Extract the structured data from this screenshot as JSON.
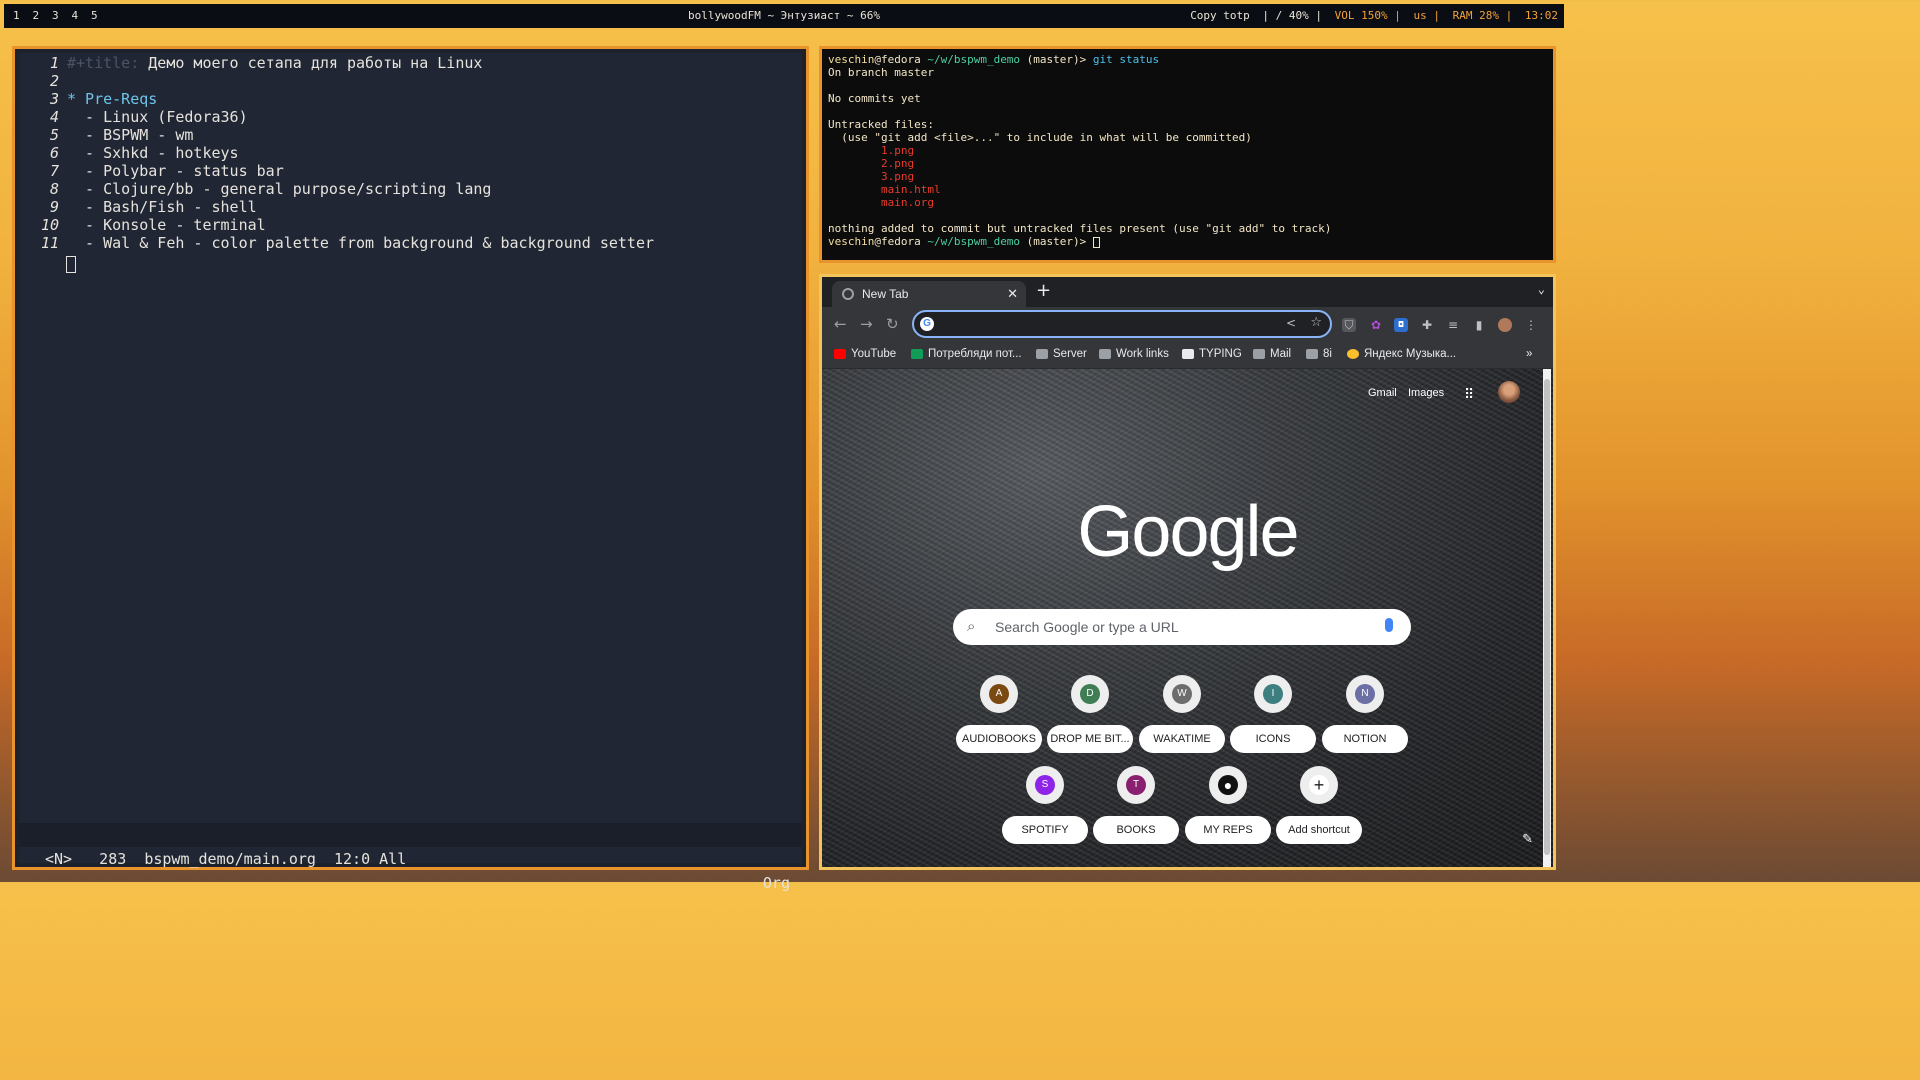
{
  "bar": {
    "workspaces": [
      "1",
      "2",
      "3",
      "4",
      "5"
    ],
    "center": "bollywoodFM ~ Энтузиаст ~ 66%",
    "right": {
      "copy": "Copy totp",
      "disk": " | / 40% |",
      "vol": " VOL 150% |",
      "lang": " us |",
      "ram": " RAM 28% |",
      "time": " 13:02"
    }
  },
  "editor": {
    "lines": [
      {
        "n": "1",
        "prefix": "#+title:",
        "text": " Демо моего сетапа для работы на Linux"
      },
      {
        "n": "2",
        "text": ""
      },
      {
        "n": "3",
        "text": "* Pre-Reqs"
      },
      {
        "n": "4",
        "text": "  - Linux (Fedora36)"
      },
      {
        "n": "5",
        "text": "  - BSPWM - wm"
      },
      {
        "n": "6",
        "text": "  - Sxhkd - hotkeys"
      },
      {
        "n": "7",
        "text": "  - Polybar - status bar"
      },
      {
        "n": "8",
        "text": "  - Clojure/bb - general purpose/scripting lang"
      },
      {
        "n": "9",
        "text": "  - Bash/Fish - shell"
      },
      {
        "n": "10",
        "text": "  - Konsole - terminal"
      },
      {
        "n": "11",
        "text": "  - Wal & Feh - color palette from background & background setter"
      }
    ],
    "modeline_left": "<N>   283  bspwm_demo/main.org  12:0 All",
    "modeline_right": "Org"
  },
  "terminal": {
    "user": "veschin",
    "host": "@fedora",
    "path": " ~/w/bspwm_demo",
    "branch": " (master)> ",
    "cmd": "git status",
    "out1": "On branch master",
    "out2": "No commits yet",
    "out3": "Untracked files:",
    "out4": "  (use \"git add <file>...\" to include in what will be committed)",
    "files": [
      "1.png",
      "2.png",
      "3.png",
      "main.html",
      "main.org"
    ],
    "out5": "nothing added to commit but untracked files present (use \"git add\" to track)"
  },
  "browser": {
    "tab_title": "New Tab",
    "bookmarks": [
      "YouTube",
      "Потребляди пот...",
      "Server",
      "Work links",
      "TYPING",
      "Mail",
      "8i",
      "Яндекс Музыка..."
    ],
    "gmail": "Gmail",
    "images": "Images",
    "logo": "Google",
    "search_placeholder": "Search Google or type a URL",
    "shortcuts": [
      {
        "letter": "A",
        "label": "AUDIOBOOKS",
        "color": "#7a4a12"
      },
      {
        "letter": "D",
        "label": "DROP ME BIT...",
        "color": "#3f7d54"
      },
      {
        "letter": "W",
        "label": "WAKATIME",
        "color": "#6d6d6d"
      },
      {
        "letter": "I",
        "label": "ICONS",
        "color": "#3d7f80"
      },
      {
        "letter": "N",
        "label": "NOTION",
        "color": "#6b6fa3"
      },
      {
        "letter": "S",
        "label": "SPOTIFY",
        "color": "#8e24e8"
      },
      {
        "letter": "T",
        "label": "BOOKS",
        "color": "#8b1f6f"
      },
      {
        "letter": "",
        "label": "MY REPS",
        "color": "#111111"
      },
      {
        "letter": "+",
        "label": "Add shortcut",
        "color": "#ffffff"
      }
    ]
  }
}
